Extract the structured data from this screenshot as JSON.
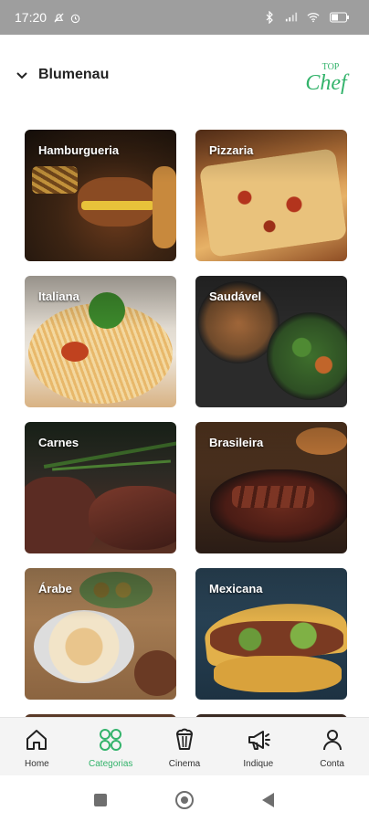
{
  "status_bar": {
    "time": "17:20"
  },
  "header": {
    "city": "Blumenau",
    "logo_top": "TOP",
    "logo_main": "Chef",
    "brand_color": "#33b36b"
  },
  "categories": [
    {
      "label": "Hamburgueria"
    },
    {
      "label": "Pizzaria"
    },
    {
      "label": "Italiana"
    },
    {
      "label": "Saudável"
    },
    {
      "label": "Carnes"
    },
    {
      "label": "Brasileira"
    },
    {
      "label": "Árabe"
    },
    {
      "label": "Mexicana"
    }
  ],
  "bottom_nav": {
    "items": [
      {
        "label": "Home",
        "icon": "home-icon"
      },
      {
        "label": "Categorias",
        "icon": "grid-icon",
        "active": true
      },
      {
        "label": "Cinema",
        "icon": "popcorn-icon"
      },
      {
        "label": "Indique",
        "icon": "megaphone-icon"
      },
      {
        "label": "Conta",
        "icon": "user-icon"
      }
    ],
    "active_color": "#33b36b"
  }
}
